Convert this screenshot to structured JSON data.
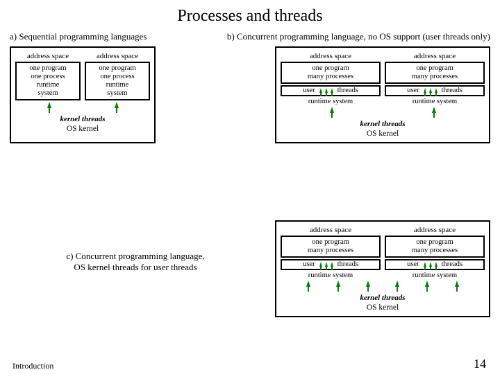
{
  "title": "Processes and threads",
  "a": {
    "caption": "a) Sequential programming languages",
    "addr": "address space",
    "box": [
      "one program",
      "one process",
      "runtime",
      "system"
    ],
    "kt": "kernel threads",
    "osk": "OS kernel"
  },
  "b": {
    "caption": "b) Concurrent programming language, no OS support (user threads only)",
    "addr": "address space",
    "box": [
      "one program",
      "many processes"
    ],
    "ut": "user     threads",
    "rt": "runtime system",
    "kt": "kernel threads",
    "osk": "OS kernel"
  },
  "c": {
    "caption": "c) Concurrent programming language,\nOS kernel threads for user threads",
    "addr": "address space",
    "box": [
      "one program",
      "many processes"
    ],
    "ut": "user     threads",
    "rt": "runtime system",
    "kt": "kernel threads",
    "osk": "OS kernel"
  },
  "footer": {
    "left": "Introduction",
    "right": "14"
  }
}
